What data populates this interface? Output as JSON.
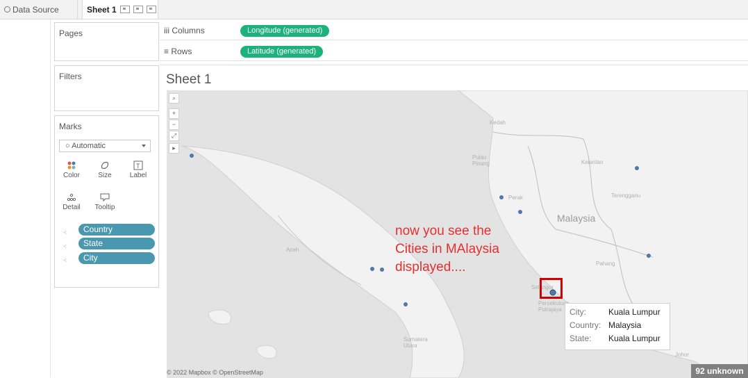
{
  "tabs": {
    "data_source": "Data Source",
    "sheet": "Sheet 1"
  },
  "cards": {
    "pages": "Pages",
    "filters": "Filters",
    "marks": "Marks",
    "mark_type": "Automatic",
    "buttons": [
      "Color",
      "Size",
      "Label",
      "Detail",
      "Tooltip"
    ],
    "fields": [
      "Country",
      "State",
      "City"
    ]
  },
  "shelves": {
    "columns_label": "Columns",
    "columns_pill": "Longitude (generated)",
    "rows_label": "Rows",
    "rows_pill": "Latitude (generated)"
  },
  "view": {
    "title": "Sheet 1",
    "annotation_line1": "now you see the",
    "annotation_line2": "Cities in MAlaysia",
    "annotation_line3": "displayed....",
    "country_label": "Malaysia",
    "region_labels": {
      "kedah": "Kedah",
      "pulau_pinang": "Pulau\nPinang",
      "kelantan": "Kelantan",
      "perak": "Perak",
      "terengganu": "Terengganu",
      "pahang": "Pahang",
      "aceh": "Aceh",
      "sumatera_utara": "Sumatera\nUtara",
      "selangor": "Selangor",
      "putrajaya": "Persekutuan\nPutrajaya",
      "johor": "Johor"
    },
    "attribution": "© 2022 Mapbox © OpenStreetMap",
    "unknown_badge": "92 unknown",
    "colors": {
      "mark_dot": "#4f79a8",
      "pill_blue": "#4a97b0",
      "pill_green": "#1db17c",
      "highlight": "#d20000"
    }
  },
  "tooltip": {
    "city_label": "City:",
    "city_value": "Kuala Lumpur",
    "country_label": "Country:",
    "country_value": "Malaysia",
    "state_label": "State:",
    "state_value": "Kuala Lumpur"
  }
}
